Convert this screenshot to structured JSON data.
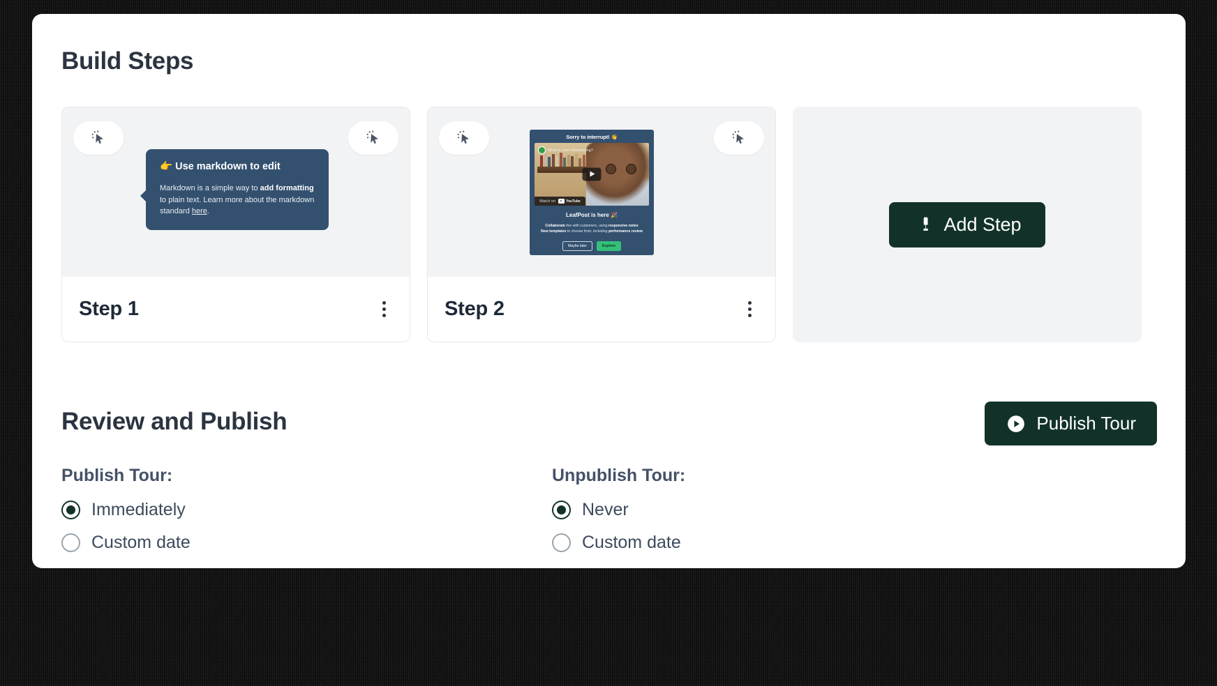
{
  "sections": {
    "build_steps_title": "Build Steps",
    "review_title": "Review and Publish"
  },
  "steps": [
    {
      "title": "Step 1",
      "preview_type": "tooltip",
      "tooltip": {
        "emoji": "👉",
        "heading": "Use markdown to edit",
        "body_1": "Markdown is a simple way to ",
        "body_bold_1": "add formatting",
        "body_2": " to plain text. Learn more about the markdown standard ",
        "link": "here",
        "body_3": "."
      }
    },
    {
      "title": "Step 2",
      "preview_type": "video",
      "video_card": {
        "heading": "Sorry to interrupt! 👋",
        "video_label": "What is User Onboarding?",
        "watch_on": "Watch on",
        "youtube": "YouTube",
        "title": "LeafPost is here 🎉",
        "bullet_1_bold": "Collaborate",
        "bullet_1": " live with customers, using ",
        "bullet_1_bold_2": "responsive notes",
        "bullet_2_bold": "New templates",
        "bullet_2": " to choose from, including ",
        "bullet_2_bold_2": "performance review",
        "btn_secondary": "Maybe later",
        "btn_primary": "Explore"
      }
    }
  ],
  "add_step": {
    "label": "Add Step",
    "icon": "hammer-icon"
  },
  "publish_button": {
    "label": "Publish Tour",
    "icon": "play-circle-icon"
  },
  "publish_options": {
    "label": "Publish Tour:",
    "options": [
      {
        "label": "Immediately",
        "selected": true
      },
      {
        "label": "Custom date",
        "selected": false
      }
    ]
  },
  "unpublish_options": {
    "label": "Unpublish Tour:",
    "options": [
      {
        "label": "Never",
        "selected": true
      },
      {
        "label": "Custom date",
        "selected": false
      }
    ]
  },
  "colors": {
    "accent_dark_green": "#123229",
    "tooltip_navy": "#33506f",
    "heading": "#2b3440",
    "panel_grey": "#f2f3f5",
    "green_primary": "#35c07a"
  },
  "icons": {
    "cursor": "cursor-click-icon",
    "kebab": "more-vertical-icon"
  }
}
